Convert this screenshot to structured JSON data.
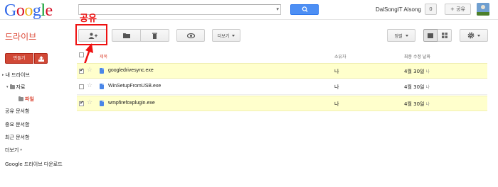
{
  "header": {
    "logo": {
      "letters": [
        "G",
        "o",
        "o",
        "g",
        "l",
        "e"
      ],
      "colors": [
        "#3369e8",
        "#d50f25",
        "#eeb211",
        "#3369e8",
        "#009925",
        "#d50f25"
      ]
    },
    "search_value": "",
    "user_name": "DalSongIT Alsong",
    "notification_count": "0",
    "share_label": "+ 공유"
  },
  "annotation": {
    "label": "공유",
    "color": "#ee1111"
  },
  "toolbar": {
    "app_title": "드라이브",
    "more_label": "더보기",
    "sort_label": "정렬"
  },
  "sidebar": {
    "new_label": "만들기",
    "items": [
      {
        "label": "내 드라이브"
      },
      {
        "label": "자료"
      },
      {
        "label": "파일"
      },
      {
        "label": "공유 문서함"
      },
      {
        "label": "중요 문서함"
      },
      {
        "label": "최근 문서함"
      },
      {
        "label": "더보기"
      },
      {
        "label": "Google 드라이브 다운로드"
      }
    ]
  },
  "list": {
    "columns": {
      "title": "제목",
      "owner": "소유자",
      "modified": "최종 수정 날짜"
    },
    "rows": [
      {
        "name": "googledrivesync.exe",
        "owner": "나",
        "date": "4월 30일",
        "by": "나",
        "selected": true
      },
      {
        "name": "WinSetupFromUSB.exe",
        "owner": "나",
        "date": "4월 30일",
        "by": "나",
        "selected": false
      },
      {
        "name": "wmpfirefoxplugin.exe",
        "owner": "나",
        "date": "4월 30일",
        "by": "나",
        "selected": true
      }
    ]
  },
  "colors": {
    "accent_red": "#dd4b39",
    "new_button": "#d14836",
    "search_button": "#4d8ff4",
    "selected_row": "#ffffcc"
  }
}
